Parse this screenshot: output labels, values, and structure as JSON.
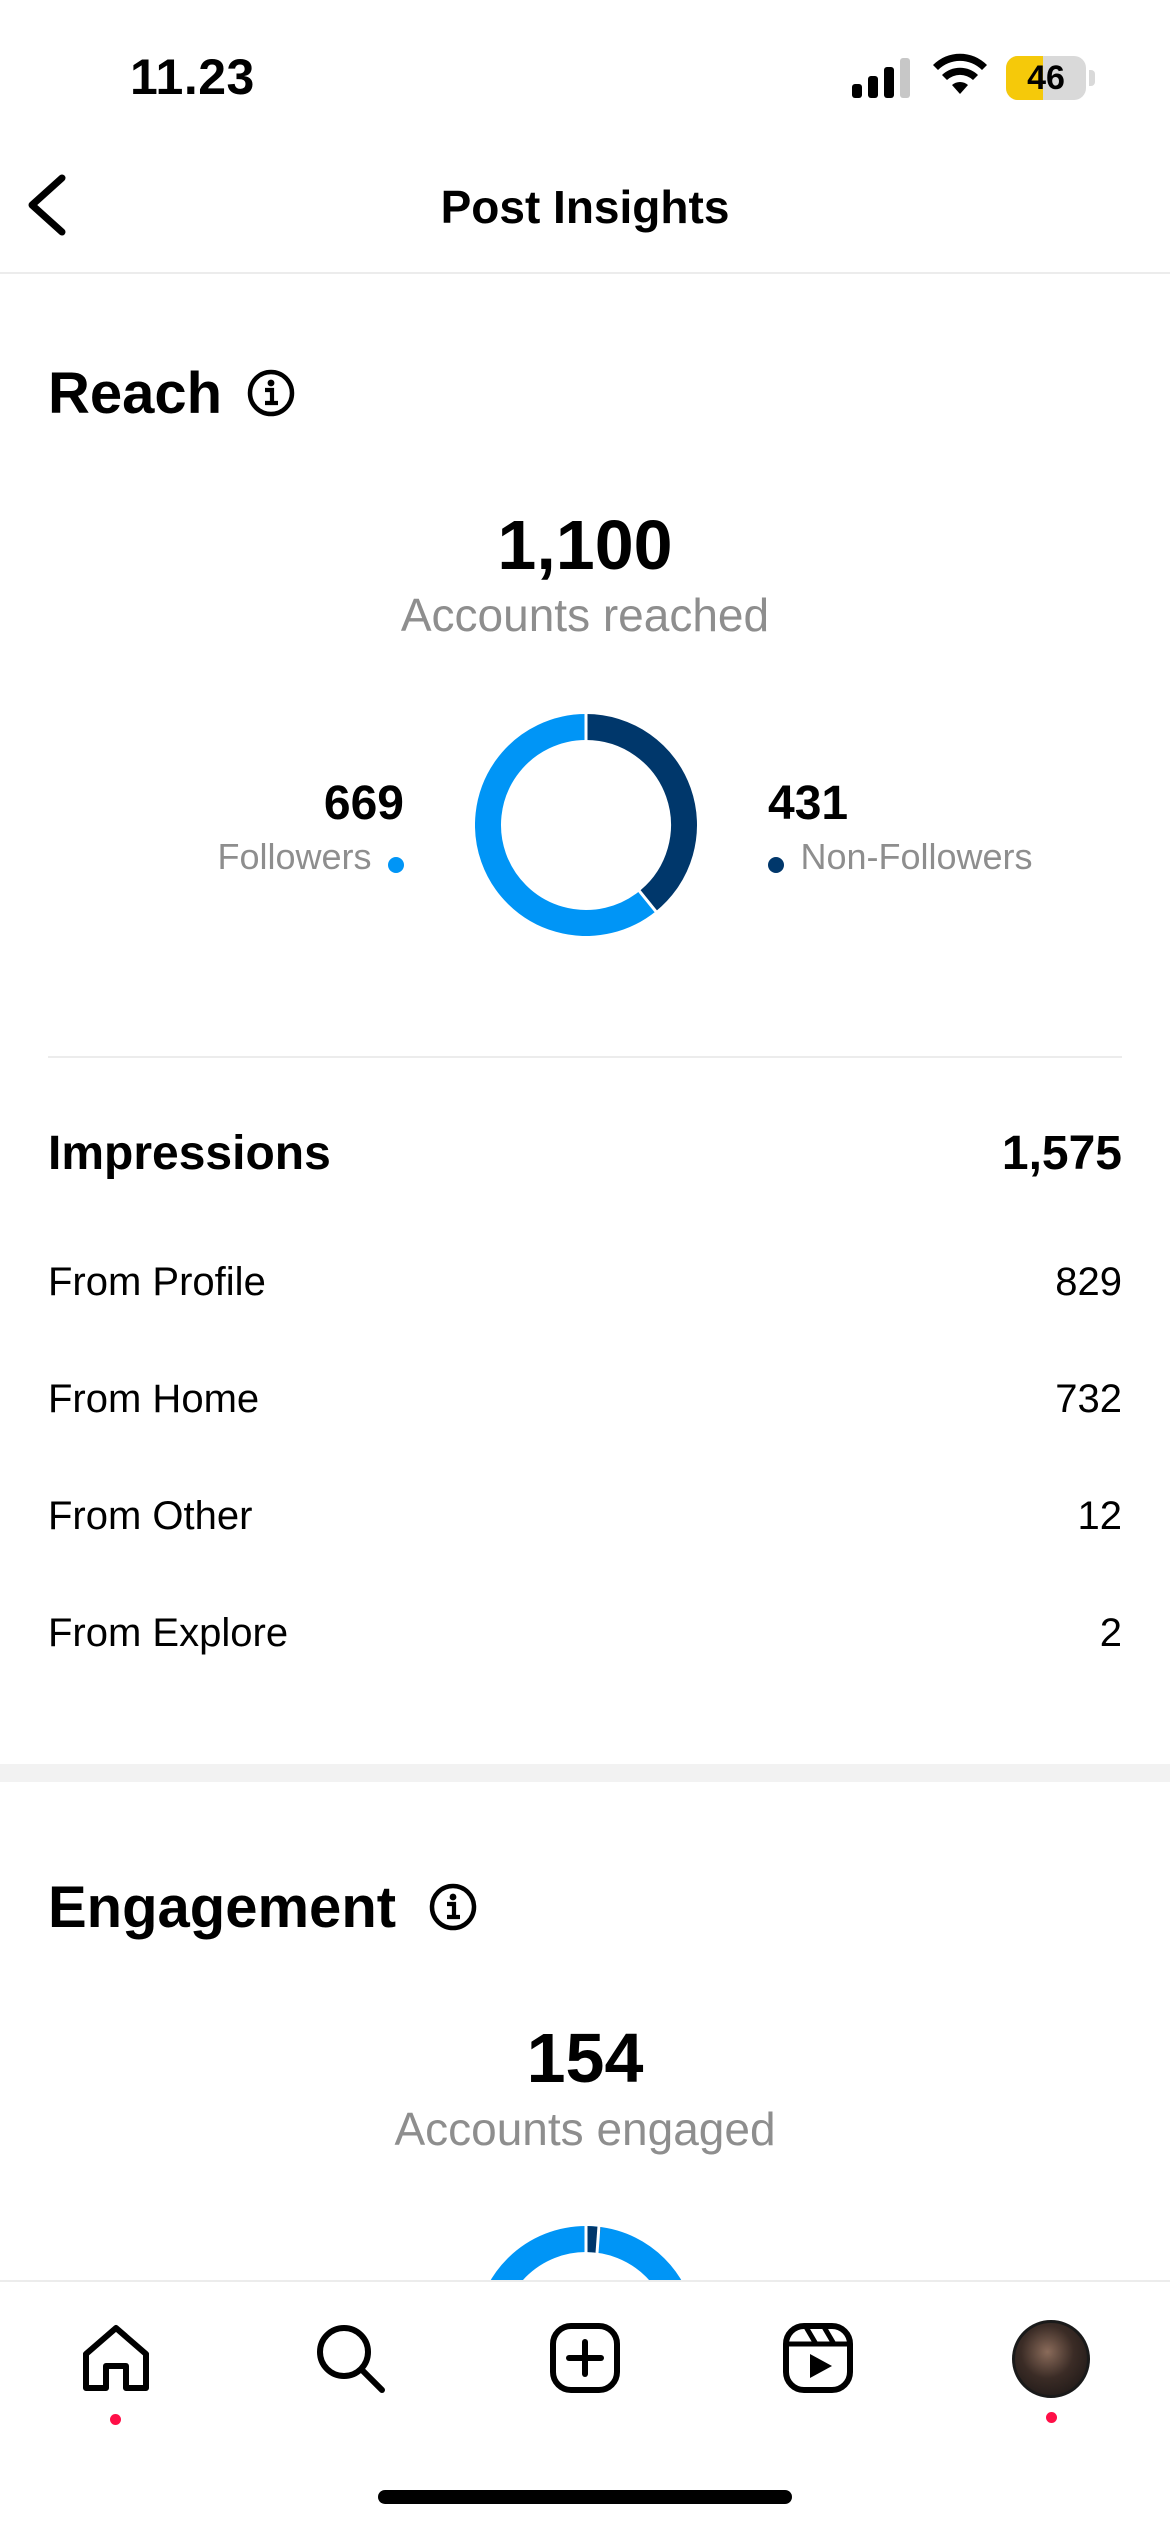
{
  "status_bar": {
    "time": "11.23",
    "battery_level": "46",
    "battery_color": "#f5c90a"
  },
  "nav": {
    "title": "Post Insights",
    "back_icon": "chevron-left-icon"
  },
  "reach": {
    "title": "Reach",
    "total": "1,100",
    "total_label": "Accounts reached",
    "followers": {
      "value": "669",
      "label": "Followers",
      "color": "#0095f6"
    },
    "non_followers": {
      "value": "431",
      "label": "Non-Followers",
      "color": "#00376b"
    }
  },
  "impressions": {
    "label": "Impressions",
    "total": "1,575",
    "rows": [
      {
        "label": "From Profile",
        "value": "829"
      },
      {
        "label": "From Home",
        "value": "732"
      },
      {
        "label": "From Other",
        "value": "12"
      },
      {
        "label": "From Explore",
        "value": "2"
      }
    ]
  },
  "engagement": {
    "title": "Engagement",
    "total": "154",
    "total_label": "Accounts engaged"
  },
  "tab_bar": {
    "items": [
      "home-icon",
      "search-icon",
      "create-icon",
      "reels-icon",
      "profile-avatar"
    ]
  },
  "chart_data": [
    {
      "type": "pie",
      "categories": [
        "Followers",
        "Non-Followers"
      ],
      "values": [
        669,
        431
      ],
      "colors": [
        "#0095f6",
        "#00376b"
      ]
    }
  ]
}
